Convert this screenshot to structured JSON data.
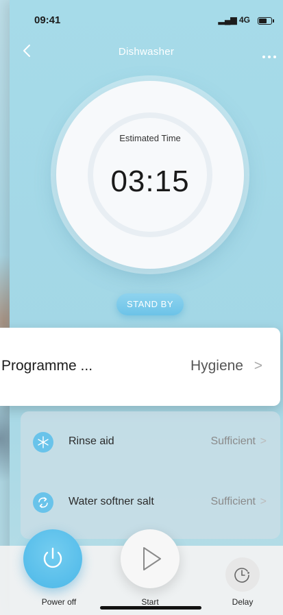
{
  "status_bar": {
    "time": "09:41",
    "network": "4G"
  },
  "nav": {
    "title": "Dishwasher"
  },
  "dial": {
    "label": "Estimated Time",
    "time": "03:15"
  },
  "state_badge": "STAND BY",
  "programme": {
    "label": "Programme ...",
    "value": "Hygiene"
  },
  "status_items": [
    {
      "label": "Rinse aid",
      "value": "Sufficient",
      "icon": "snowflake-icon"
    },
    {
      "label": "Water softner salt",
      "value": "Sufficient",
      "icon": "recycle-icon"
    }
  ],
  "controls": {
    "power_label": "Power off",
    "start_label": "Start",
    "delay_label": "Delay"
  },
  "colors": {
    "accent": "#5bbfe9",
    "background": "#a6dbe9"
  }
}
